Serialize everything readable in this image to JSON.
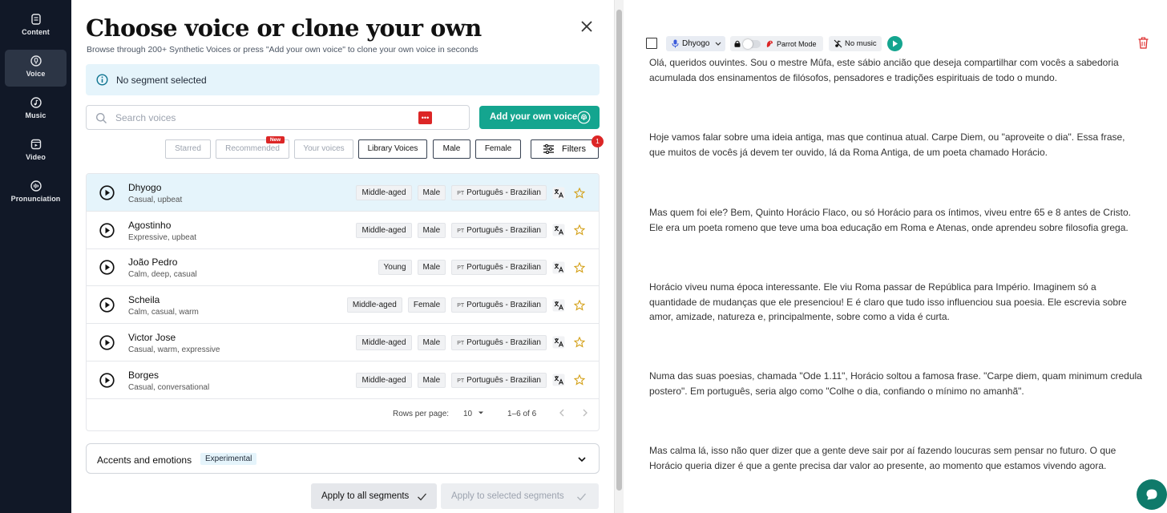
{
  "nav": {
    "items": [
      {
        "label": "Content",
        "icon": "document-icon",
        "active": false
      },
      {
        "label": "Voice",
        "icon": "voice-icon",
        "active": true
      },
      {
        "label": "Music",
        "icon": "music-icon",
        "active": false
      },
      {
        "label": "Video",
        "icon": "video-icon",
        "active": false
      },
      {
        "label": "Pronunciation",
        "icon": "waveform-icon",
        "active": false
      }
    ]
  },
  "panel": {
    "title": "Choose voice or clone your own",
    "subtitle": "Browse through 200+ Synthetic Voices or press \"Add your own voice\" to clone your own voice in seconds",
    "info_text": "No segment selected",
    "search": {
      "placeholder": "Search voices",
      "value": ""
    },
    "add_voice_label": "Add your own voice",
    "filter_chips": {
      "starred": "Starred",
      "recommended": "Recommended",
      "new_badge": "New",
      "your_voices": "Your voices",
      "library_voices": "Library Voices",
      "male": "Male",
      "female": "Female"
    },
    "filters": {
      "label": "Filters",
      "count": "1"
    },
    "voices": [
      {
        "name": "Dhyogo",
        "desc": "Casual, upbeat",
        "age": "Middle-aged",
        "gender": "Male",
        "lang_code": "PT",
        "language": "Português - Brazilian",
        "selected": true
      },
      {
        "name": "Agostinho",
        "desc": "Expressive, upbeat",
        "age": "Middle-aged",
        "gender": "Male",
        "lang_code": "PT",
        "language": "Português - Brazilian",
        "selected": false
      },
      {
        "name": "João Pedro",
        "desc": "Calm, deep, casual",
        "age": "Young",
        "gender": "Male",
        "lang_code": "PT",
        "language": "Português - Brazilian",
        "selected": false
      },
      {
        "name": "Scheila",
        "desc": "Calm, casual, warm",
        "age": "Middle-aged",
        "gender": "Female",
        "lang_code": "PT",
        "language": "Português - Brazilian",
        "selected": false
      },
      {
        "name": "Victor Jose",
        "desc": "Casual, warm, expressive",
        "age": "Middle-aged",
        "gender": "Male",
        "lang_code": "PT",
        "language": "Português - Brazilian",
        "selected": false
      },
      {
        "name": "Borges",
        "desc": "Casual, conversational",
        "age": "Middle-aged",
        "gender": "Male",
        "lang_code": "PT",
        "language": "Português - Brazilian",
        "selected": false
      }
    ],
    "pagination": {
      "rows_label": "Rows per page:",
      "rows_value": "10",
      "range": "1–6 of 6"
    },
    "accents": {
      "label": "Accents and emotions",
      "badge": "Experimental"
    },
    "apply_all": "Apply to all segments",
    "apply_selected": "Apply to selected segments"
  },
  "script": {
    "toolbar": {
      "voice": "Dhyogo",
      "parrot_mode": "Parrot Mode",
      "music": "No music"
    },
    "paragraphs": [
      "Olá, queridos ouvintes. Sou o mestre Mûfa, este sábio ancião que deseja compartilhar com vocês a sabedoria acumulada dos ensinamentos de filósofos, pensadores e tradições espirituais de todo o mundo.",
      "Hoje vamos falar sobre uma ideia antiga, mas que continua atual. Carpe Diem, ou \"aproveite o dia\". Essa frase, que muitos de vocês já devem ter ouvido, lá da Roma Antiga, de um poeta chamado Horácio.",
      "Mas quem foi ele? Bem, Quinto Horácio Flaco, ou só Horácio para os íntimos, viveu entre 65 e 8 antes de Cristo. Ele era um poeta romeno que teve uma boa educação em Roma e Atenas, onde aprendeu sobre filosofia grega.",
      "Horácio viveu numa época interessante. Ele viu Roma passar de República para Império. Imaginem só a quantidade de mudanças que ele presenciou! E é claro que tudo isso influenciou sua poesia. Ele escrevia sobre amor, amizade, natureza e, principalmente, sobre como a vida é curta.",
      "Numa das suas poesias, chamada \"Ode 1.11\", Horácio soltou a famosa frase. \"Carpe diem, quam minimum credula postero\". Em português, seria algo como \"Colhe o dia, confiando o mínimo no amanhã\".",
      "Mas calma lá, isso não quer dizer que a gente deve sair por aí fazendo loucuras sem pensar no futuro. O que Horácio queria dizer é que a gente precisa dar valor ao presente, ao momento que estamos vivendo agora."
    ]
  },
  "colors": {
    "accent": "#14a58f",
    "sidebar": "#111827",
    "info_bg": "#e5f4fb",
    "danger": "#dc2626"
  }
}
